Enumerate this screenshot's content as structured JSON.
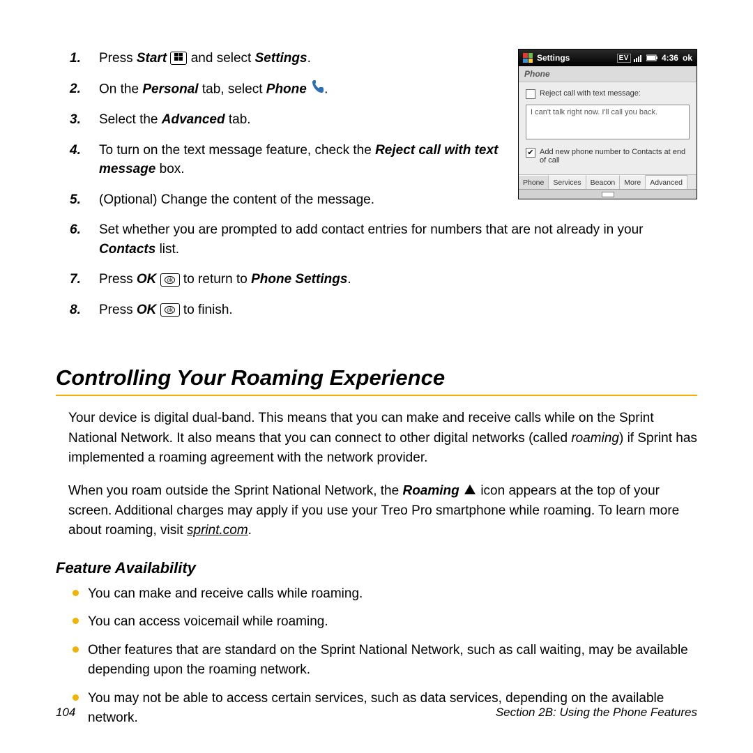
{
  "screenshot": {
    "header_title": "Settings",
    "status_ev": "EV",
    "status_time": "4:36",
    "status_ok": "ok",
    "sub_title": "Phone",
    "reject_label": "Reject call with text message:",
    "reject_msg": "I can't talk right now. I'll call you back.",
    "add_contact_label": "Add new phone number to Contacts at end of call",
    "tabs": [
      "Phone",
      "Services",
      "Beacon",
      "More",
      "Advanced"
    ]
  },
  "steps": {
    "s1a": "Press ",
    "s1b": "Start",
    "s1c": " and select ",
    "s1d": "Settings",
    "s1e": ".",
    "s2a": "On the ",
    "s2b": "Personal",
    "s2c": " tab, select ",
    "s2d": "Phone",
    "s2e": ".",
    "s3a": "Select the ",
    "s3b": "Advanced",
    "s3c": " tab.",
    "s4a": "To turn on the text message feature, check the ",
    "s4b": "Reject call with text message",
    "s4c": " box.",
    "s5": "(Optional) Change the content of the message.",
    "s6a": "Set whether you are prompted to add contact entries for numbers that are not already in your ",
    "s6b": "Contacts",
    "s6c": " list.",
    "s7a": "Press ",
    "s7b": "OK",
    "s7c": " to return to ",
    "s7d": "Phone Settings",
    "s7e": ".",
    "s8a": "Press ",
    "s8b": "OK",
    "s8c": " to finish."
  },
  "headings": {
    "roaming": "Controlling Your Roaming Experience",
    "feature": "Feature Availability"
  },
  "paras": {
    "p1a": "Your device is digital dual-band. This means that you can make and receive calls while on the Sprint National Network. It also means that you can connect to other digital networks (called ",
    "p1b": "roaming",
    "p1c": ") if Sprint has implemented a roaming agreement with the network provider.",
    "p2a": "When you roam outside the Sprint National Network, the ",
    "p2b": "Roaming",
    "p2c": " icon appears at the top of your screen. Additional charges may apply if you use your Treo Pro smartphone while roaming. To learn more about roaming, visit ",
    "p2d": "sprint.com",
    "p2e": "."
  },
  "bullets": {
    "b1": "You can make and receive calls while roaming.",
    "b2": "You can access voicemail while roaming.",
    "b3": "Other features that are standard on the Sprint National Network, such as call waiting, may be available depending upon the roaming network.",
    "b4": "You may not be able to access certain services, such as data services, depending on the available network."
  },
  "footer": {
    "page": "104",
    "section": "Section 2B: Using the Phone Features"
  },
  "icons": {
    "ok_text": "ok"
  }
}
